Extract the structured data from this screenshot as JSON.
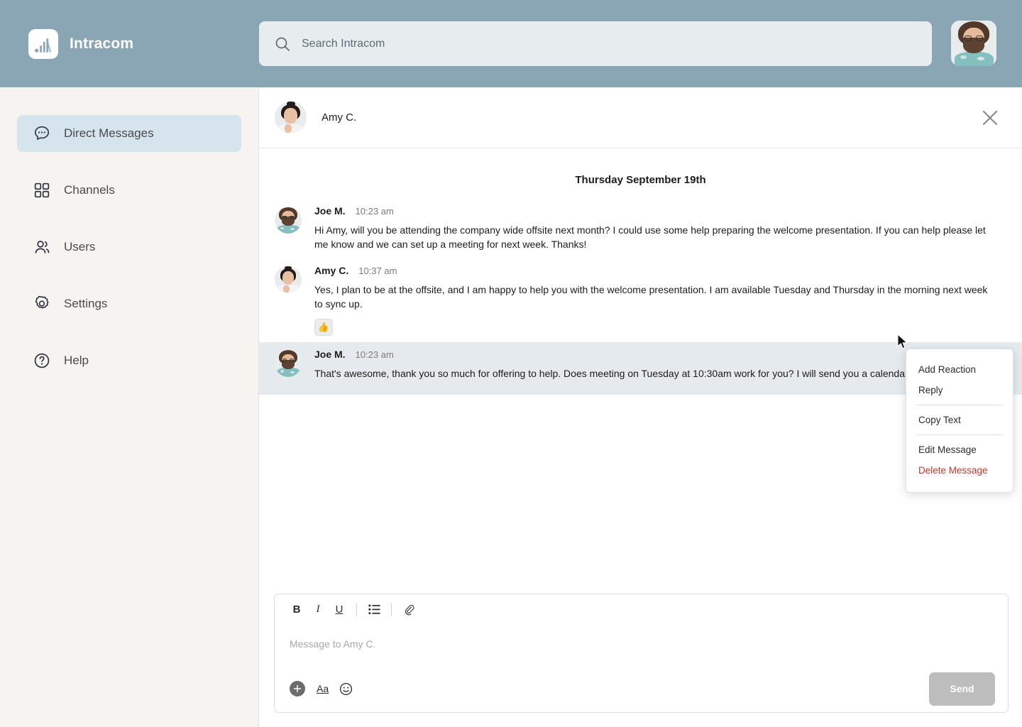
{
  "app": {
    "name": "Intracom",
    "logo_icon": "bars-logo-icon",
    "header_color": "#8aa5b4",
    "sidebar_color": "#f7f3f1",
    "active_nav_color": "#d5e4ed"
  },
  "search": {
    "placeholder": "Search Intracom",
    "value": "",
    "icon": "search-icon"
  },
  "account": {
    "avatar": "avatar-joe-m"
  },
  "sidebar": {
    "items": [
      {
        "label": "Direct Messages",
        "icon": "chat-bubble-icon",
        "active": true
      },
      {
        "label": "Channels",
        "icon": "grid-squares-icon",
        "active": false
      },
      {
        "label": "Users",
        "icon": "users-icon",
        "active": false
      },
      {
        "label": "Settings",
        "icon": "gear-icon",
        "active": false
      },
      {
        "label": "Help",
        "icon": "question-circle-icon",
        "active": false
      }
    ]
  },
  "conversation": {
    "title": "Amy C.",
    "avatar": "avatar-amy-c",
    "close_icon": "close-icon",
    "date_divider": "Thursday September 19th",
    "messages": [
      {
        "author": "Joe M.",
        "time": "10:23 am",
        "avatar": "avatar-joe-m",
        "text": "Hi Amy, will you be attending the company wide offsite next month? I could use some help preparing the welcome presentation. If you can help please let me know and we can set up a meeting for next week. Thanks!",
        "reaction": "",
        "highlighted": false
      },
      {
        "author": "Amy C.",
        "time": "10:37 am",
        "avatar": "avatar-amy-c",
        "text": "Yes, I plan to be at the offsite, and I am happy to help you with the welcome presentation. I am available Tuesday and Thursday in the morning next week to sync up.",
        "reaction": "👍",
        "highlighted": false
      },
      {
        "author": "Joe M.",
        "time": "10:23 am",
        "avatar": "avatar-joe-m",
        "text": "That's awesome, thank you so much for offering to help. Does meeting on Tuesday at 10:30am work for you? I will send you a calendar invite.",
        "reaction": "",
        "highlighted": true
      }
    ]
  },
  "context_menu": {
    "items": [
      {
        "label": "Add Reaction",
        "danger": false
      },
      {
        "label": "Reply",
        "danger": false
      },
      {
        "label": "Copy Text",
        "danger": false
      },
      {
        "label": "Edit Message",
        "danger": false
      },
      {
        "label": "Delete Message",
        "danger": true
      }
    ],
    "danger_color": "#c8352c"
  },
  "composer": {
    "placeholder": "Message to Amy C.",
    "value": "",
    "toolbar": {
      "bold": "B",
      "italic": "I",
      "underline": "U",
      "list_icon": "bulleted-list-icon",
      "link_icon": "paperclip-icon"
    },
    "actions": {
      "plus_icon": "plus-circle-icon",
      "format_label": "Aa",
      "emoji_icon": "emoji-smiley-icon"
    },
    "send_label": "Send",
    "send_disabled": true
  }
}
